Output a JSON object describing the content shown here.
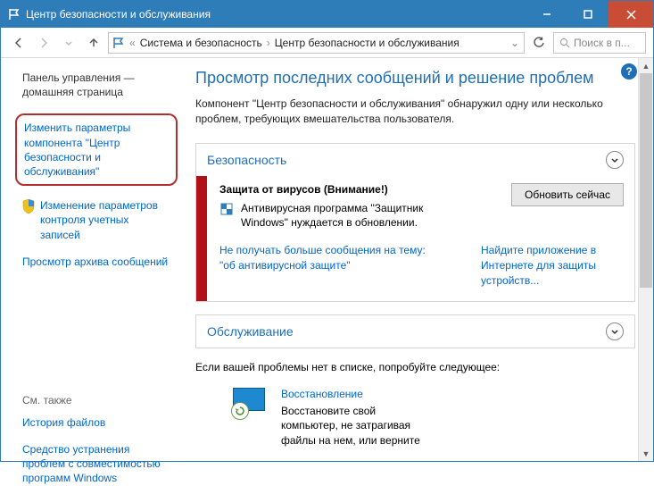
{
  "titlebar": {
    "title": "Центр безопасности и обслуживания"
  },
  "breadcrumb": {
    "item1": "Система и безопасность",
    "item2": "Центр безопасности и обслуживания"
  },
  "search": {
    "placeholder": "Поиск в п..."
  },
  "sidebar": {
    "home": "Панель управления — домашняя страница",
    "change_params": "Изменить параметры компонента \"Центр безопасности и обслуживания\"",
    "uac": "Изменение параметров контроля учетных записей",
    "archive": "Просмотр архива сообщений",
    "seealso_label": "См. также",
    "file_history": "История файлов",
    "compat": "Средство устранения проблем с совместимостью программ Windows"
  },
  "main": {
    "heading": "Просмотр последних сообщений и решение проблем",
    "intro": "Компонент \"Центр безопасности и обслуживания\" обнаружил одну или несколько проблем, требующих вмешательства пользователя.",
    "security": {
      "title": "Безопасность",
      "alert_title": "Защита от вирусов  (Внимание!)",
      "alert_desc": "Антивирусная программа \"Защитник Windows\" нуждается в обновлении.",
      "update_btn": "Обновить сейчас",
      "link_left": "Не получать больше сообщения на тему: \"об антивирусной защите\"",
      "link_right": "Найдите приложение в Интернете для защиты устройств..."
    },
    "maintenance": {
      "title": "Обслуживание"
    },
    "suggest": "Если вашей проблемы нет в списке, попробуйте следующее:",
    "recovery": {
      "title": "Восстановление",
      "desc": "Восстановите свой компьютер, не затрагивая файлы на нем, или верните"
    }
  }
}
